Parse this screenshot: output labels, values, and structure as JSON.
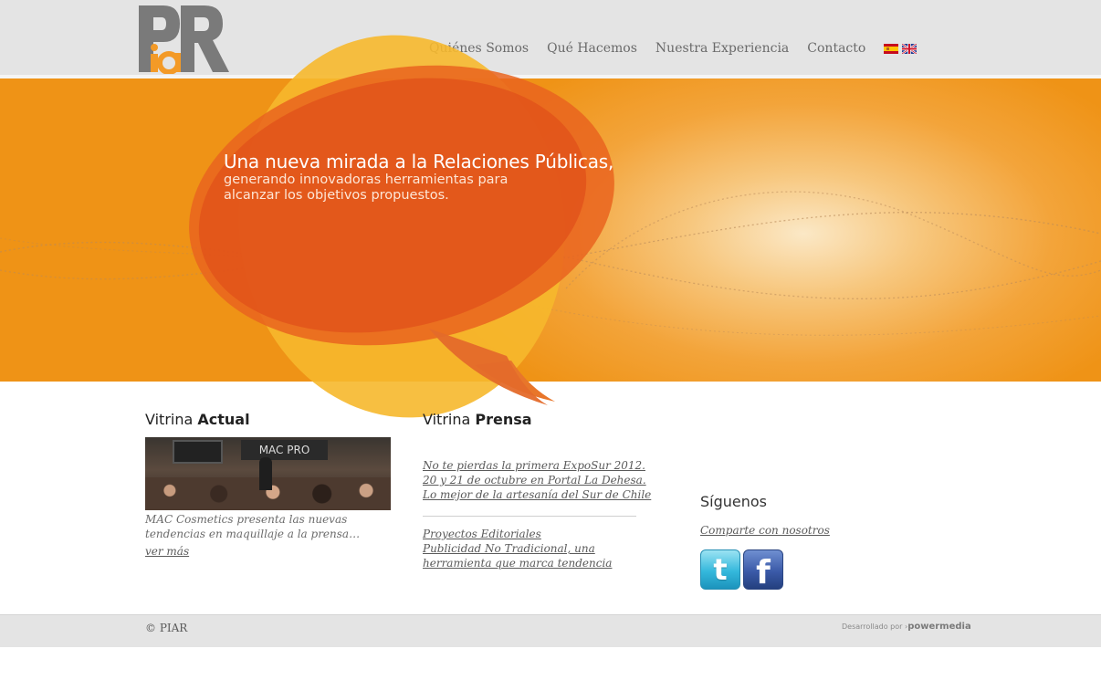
{
  "brand": {
    "logo_text": "PiaR"
  },
  "nav": {
    "items": [
      {
        "label": "Quiénes Somos"
      },
      {
        "label": "Qué Hacemos"
      },
      {
        "label": "Nuestra Experiencia"
      },
      {
        "label": "Contacto"
      }
    ],
    "languages": [
      "Español",
      "English"
    ]
  },
  "hero": {
    "title": "Una nueva mirada a la Relaciones Públicas,",
    "subtitle": "generando innovadoras herramientas para alcanzar los objetivos propuestos."
  },
  "vitrina_actual": {
    "title_light": "Vitrina ",
    "title_bold": "Actual",
    "image_caption": "MAC PRO",
    "text": "MAC Cosmetics presenta las nuevas tendencias en maquillaje a la prensa…",
    "more_link": "ver más"
  },
  "vitrina_prensa": {
    "title_light": "Vitrina ",
    "title_bold": "Prensa",
    "group1": [
      "No te pierdas la primera ExpoSur 2012.",
      "20 y 21 de octubre en Portal La Dehesa.",
      "Lo mejor de la artesanía del Sur de Chile"
    ],
    "group2": [
      "Proyectos Editoriales",
      "Publicidad No Tradicional, una",
      "herramienta que marca tendencia"
    ]
  },
  "social": {
    "title": "Síguenos",
    "share_link": "Comparte con nosotros",
    "twitter_glyph": "t",
    "facebook_glyph": "f"
  },
  "footer": {
    "copyright": "© PIAR",
    "dev_prefix": "Desarrollado por ",
    "dev_name": "powermedia"
  },
  "colors": {
    "accent_orange": "#ef9316",
    "bubble_red": "#e0501a",
    "bubble_yellow": "#f6b82c"
  }
}
